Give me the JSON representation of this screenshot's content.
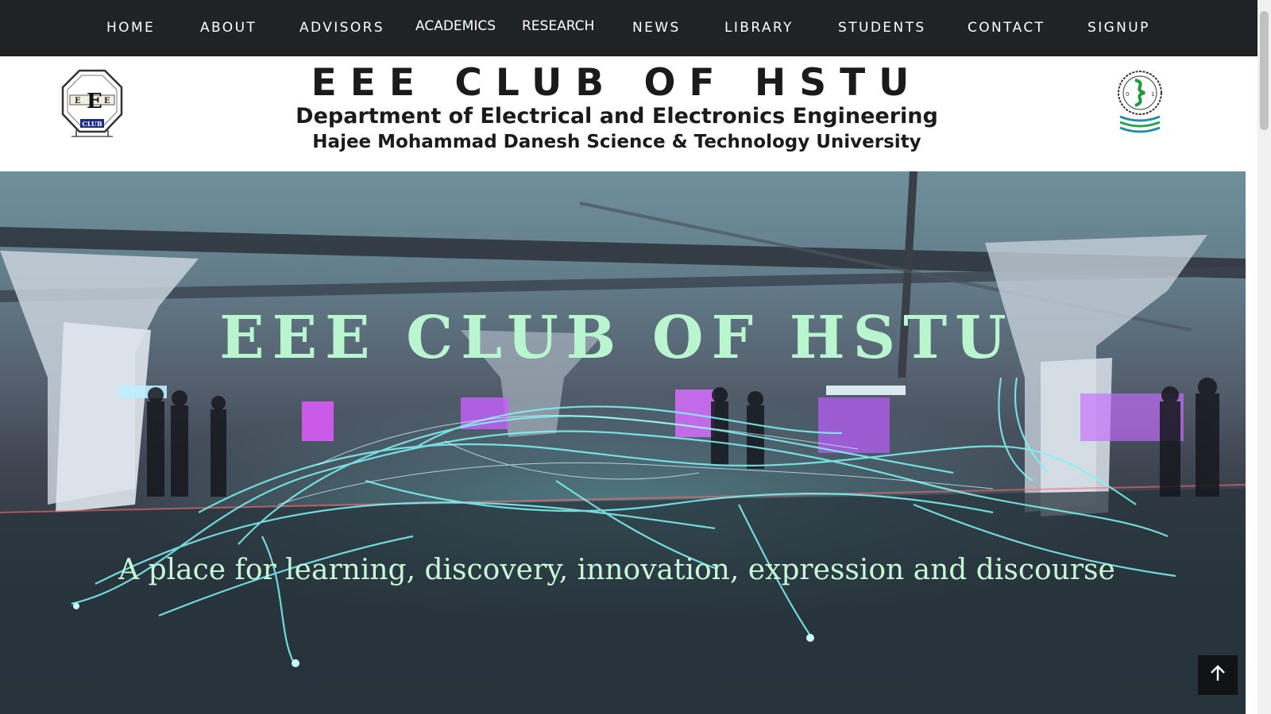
{
  "nav": {
    "items": [
      {
        "label": "HOME"
      },
      {
        "label": "ABOUT"
      },
      {
        "label": "ADVISORS"
      },
      {
        "label": "ACADEMICS"
      },
      {
        "label": "RESEARCH"
      },
      {
        "label": "NEWS"
      },
      {
        "label": "LIBRARY"
      },
      {
        "label": "STUDENTS"
      },
      {
        "label": "CONTACT"
      },
      {
        "label": "SIGNUP"
      }
    ]
  },
  "header": {
    "title": "EEE CLUB OF HSTU",
    "department": "Department of Electrical and Electronics Engineering",
    "university": "Hajee Mohammad Danesh Science & Technology University",
    "logo_left_text": "CLUB"
  },
  "hero": {
    "title": "EEE CLUB OF HSTU",
    "tagline": "A place for learning, discovery, innovation, expression and discourse"
  },
  "icons": {
    "scroll_top": "arrow-up-icon",
    "left_logo": "eee-club-logo",
    "right_logo": "hstu-logo"
  },
  "colors": {
    "nav_bg": "#1f2326",
    "hero_title": "#b9f5cf",
    "accent_cyan": "#6ff0f0"
  }
}
